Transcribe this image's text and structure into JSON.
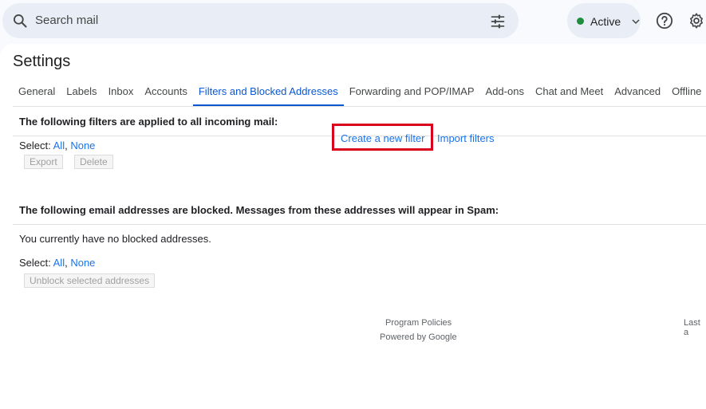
{
  "search": {
    "placeholder": "Search mail",
    "icon": "search-icon",
    "options_icon": "tune-icon"
  },
  "status": {
    "label": "Active",
    "color": "#1e8e3e"
  },
  "settings": {
    "title": "Settings"
  },
  "tabs": [
    {
      "label": "General",
      "active": false
    },
    {
      "label": "Labels",
      "active": false
    },
    {
      "label": "Inbox",
      "active": false
    },
    {
      "label": "Accounts",
      "active": false
    },
    {
      "label": "Filters and Blocked Addresses",
      "active": true
    },
    {
      "label": "Forwarding and POP/IMAP",
      "active": false
    },
    {
      "label": "Add-ons",
      "active": false
    },
    {
      "label": "Chat and Meet",
      "active": false
    },
    {
      "label": "Advanced",
      "active": false
    },
    {
      "label": "Offline",
      "active": false
    }
  ],
  "filters": {
    "heading": "The following filters are applied to all incoming mail:",
    "select_label": "Select: ",
    "select_all": "All",
    "select_sep": ", ",
    "select_none": "None",
    "export_label": "Export",
    "delete_label": "Delete",
    "create_label": "Create a new filter",
    "import_label": "Import filters"
  },
  "blocked": {
    "heading": "The following email addresses are blocked. Messages from these addresses will appear in Spam:",
    "empty_text": "You currently have no blocked addresses.",
    "select_label": "Select: ",
    "select_all": "All",
    "select_sep": ", ",
    "select_none": "None",
    "unblock_label": "Unblock selected addresses"
  },
  "footer": {
    "policies": "Program Policies",
    "powered": "Powered by Google",
    "last_activity": "Last a"
  },
  "colors": {
    "accent": "#0b57d0",
    "link": "#1a73e8",
    "highlight": "#d9001b"
  }
}
